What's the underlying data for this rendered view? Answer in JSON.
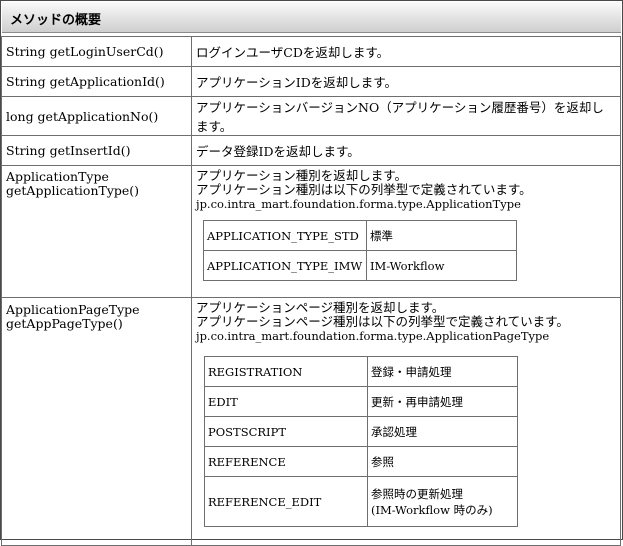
{
  "header": {
    "title": "メソッドの概要"
  },
  "methods": [
    {
      "name": "String getLoginUserCd()",
      "desc": "ログインユーザCDを返却します。"
    },
    {
      "name": "String getApplicationId()",
      "desc": "アプリケーションIDを返却します。"
    },
    {
      "name": "long getApplicationNo()",
      "desc": "アプリケーションバージョンNO（アプリケーション履歴番号）を返却します。"
    },
    {
      "name": "String getInsertId()",
      "desc": "データ登録IDを返却します。"
    }
  ],
  "app_type": {
    "name_line1": "ApplicationType",
    "name_line2": "getApplicationType()",
    "desc_line1": "アプリケーション種別を返却します。",
    "desc_line2": "アプリケーション種別は以下の列挙型で定義されています。",
    "package": "jp.co.intra_mart.foundation.forma.type.ApplicationType",
    "rows": [
      {
        "key": "APPLICATION_TYPE_STD",
        "value": "標準"
      },
      {
        "key": "APPLICATION_TYPE_IMW",
        "value": "IM-Workflow"
      }
    ]
  },
  "page_type": {
    "name_line1": "ApplicationPageType",
    "name_line2": "getAppPageType()",
    "desc_line1": "アプリケーションページ種別を返却します。",
    "desc_line2": "アプリケーションページ種別は以下の列挙型で定義されています。",
    "package": "jp.co.intra_mart.foundation.forma.type.ApplicationPageType",
    "rows": [
      {
        "key": "REGISTRATION",
        "value": "登録・申請処理",
        "value2": ""
      },
      {
        "key": "EDIT",
        "value": "更新・再申請処理",
        "value2": ""
      },
      {
        "key": "POSTSCRIPT",
        "value": "承認処理",
        "value2": ""
      },
      {
        "key": "REFERENCE",
        "value": "参照",
        "value2": ""
      },
      {
        "key": "REFERENCE_EDIT",
        "value": "参照時の更新処理",
        "value2": "(IM-Workflow 時のみ)"
      }
    ]
  }
}
